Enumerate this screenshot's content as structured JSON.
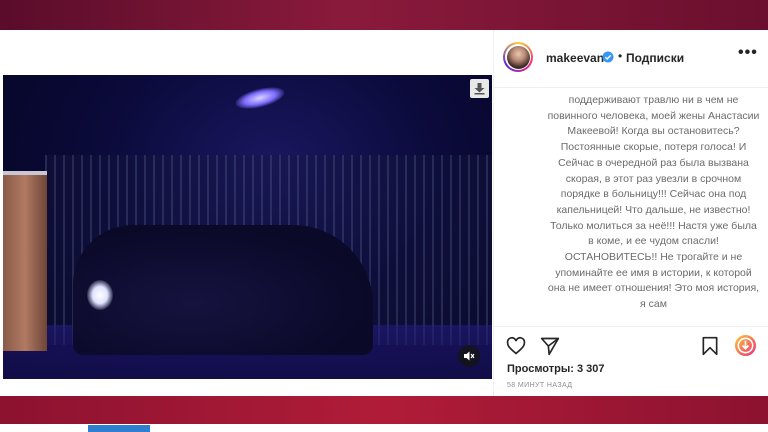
{
  "post": {
    "username": "makeevan",
    "separator": "•",
    "follow_status": "Подписки",
    "more": "•••",
    "caption": "поддерживают травлю ни в чем не повинного человека, моей жены Анастасии Макеевой! Когда вы остановитесь? Постоянные скорые, потеря голоса! И Сейчас в очередной раз была вызвана скорая, в этот раз увезли в срочном порядке в больницу!!! Сейчас она под капельницей! Что дальше, не известно! Только молиться за неё!!! Настя уже была в коме, и ее чудом спасли! ОСТАНОВИТЕСЬ!! Не трогайте и не упоминайте ее имя в истории, к которой она не имеет отношения! Это моя история, я сам",
    "views": "Просмотры: 3 307",
    "timestamp": "58 МИНУТ НАЗАД"
  },
  "icons": {
    "verified": "verified-badge-icon",
    "download": "download-icon",
    "mute": "speaker-muted-icon",
    "like": "heart-icon",
    "share": "paper-plane-icon",
    "save": "bookmark-icon",
    "extension": "circular-download-icon"
  },
  "colors": {
    "verified_blue": "#3897f0",
    "frame_maroon": "#8c1230",
    "extension_gradient": [
      "#f9ce34",
      "#ee2a7b"
    ]
  }
}
